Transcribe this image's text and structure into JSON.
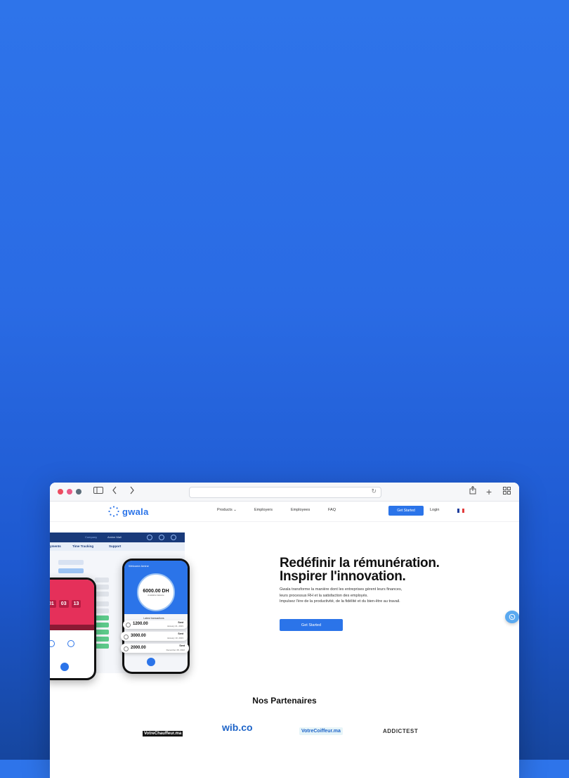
{
  "browser": {
    "nav_back_icon": "chevron-left-icon",
    "nav_forward_icon": "chevron-right-icon"
  },
  "site": {
    "logo_text": "gwala",
    "nav": {
      "products": "Products ⌄",
      "employers": "Employers",
      "employees": "Employees",
      "faq": "FAQ",
      "cta": "Get Started",
      "login": "Login"
    },
    "hero": {
      "title_line1": "Redéfinir la rémunération.",
      "title_line2": "Inspirer l'innovation.",
      "text_line1": "Gwala transforme la manière dont les entreprises gèrent leurs finances,",
      "text_line2": "leurs processus RH et la satisfaction des employés.",
      "text_line3": "Impulsez l'ère de la productivité, de la fidélité et du bien-être au travail.",
      "cta": "Get Started"
    },
    "dashboard": {
      "tab1": "yments",
      "tab2": "Time Tracking",
      "tab3": "Support",
      "company": "Company",
      "user": "Amine Mali"
    },
    "phone_front": {
      "greeting": "Welcome Amine",
      "balance": "6000.00 DH",
      "balance_label": "Available balance",
      "transactions_title": "Latest transactions",
      "tx": [
        {
          "amount": "1200.00",
          "status": "Sent",
          "date": "January 21, 2023"
        },
        {
          "amount": "3000.00",
          "status": "Sent",
          "date": "January 10, 2023"
        },
        {
          "amount": "2000.00",
          "status": "Sent",
          "date": "December 28, 2022"
        }
      ]
    },
    "phone_back": {
      "timer": [
        "01",
        "03",
        "13"
      ]
    },
    "partners": {
      "title": "Nos Partenaires",
      "logos": [
        "VotreChauffeur.ma",
        "wib.co",
        "VotreCoiffeur.ma",
        "ADDICTEST"
      ]
    },
    "chat_icon": "whatsapp-icon"
  },
  "colors": {
    "brand": "#2b74e9",
    "background_top": "#2e74ea",
    "background_bottom": "#16469f"
  }
}
